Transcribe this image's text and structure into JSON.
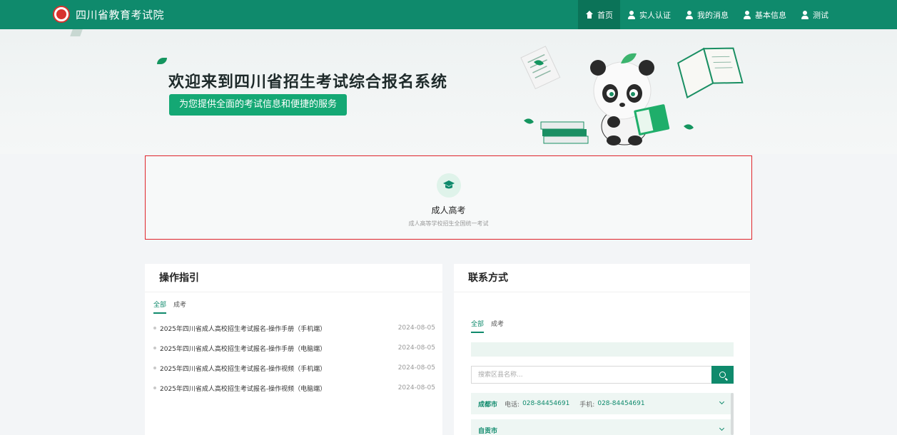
{
  "brand": {
    "name": "四川省教育考试院"
  },
  "nav": [
    {
      "label": "首页",
      "icon": "home-icon",
      "active": true
    },
    {
      "label": "实人认证",
      "icon": "user-icon"
    },
    {
      "label": "我的消息",
      "icon": "user-icon"
    },
    {
      "label": "基本信息",
      "icon": "user-icon"
    },
    {
      "label": "测试",
      "icon": "user-icon"
    }
  ],
  "hero": {
    "title": "欢迎来到四川省招生考试综合报名系统",
    "subtitle": "为您提供全面的考试信息和便捷的服务"
  },
  "exam": {
    "title": "成人高考",
    "description": "成人高等学校招生全国统一考试",
    "icon": "graduation-cap-icon"
  },
  "guide": {
    "title": "操作指引",
    "tabs": [
      "全部",
      "成考"
    ],
    "items": [
      {
        "title": "2025年四川省成人高校招生考试报名-操作手册（手机端）",
        "date": "2024-08-05"
      },
      {
        "title": "2025年四川省成人高校招生考试报名-操作手册（电脑端）",
        "date": "2024-08-05"
      },
      {
        "title": "2025年四川省成人高校招生考试报名-操作视频（手机端）",
        "date": "2024-08-05"
      },
      {
        "title": "2025年四川省成人高校招生考试报名-操作视频（电脑端）",
        "date": "2024-08-05"
      }
    ]
  },
  "contact": {
    "title": "联系方式",
    "tabs": [
      "全部",
      "成考"
    ],
    "search_placeholder": "搜索区县名称...",
    "phone_label": "电话:",
    "mobile_label": "手机:",
    "cities": [
      {
        "name": "成都市",
        "phone": "028-84454691",
        "mobile": "028-84454691"
      },
      {
        "name": "自贡市"
      }
    ]
  },
  "colors": {
    "primary": "#0f8a6c",
    "accent": "#14a874",
    "highlight_border": "#e0252b"
  }
}
